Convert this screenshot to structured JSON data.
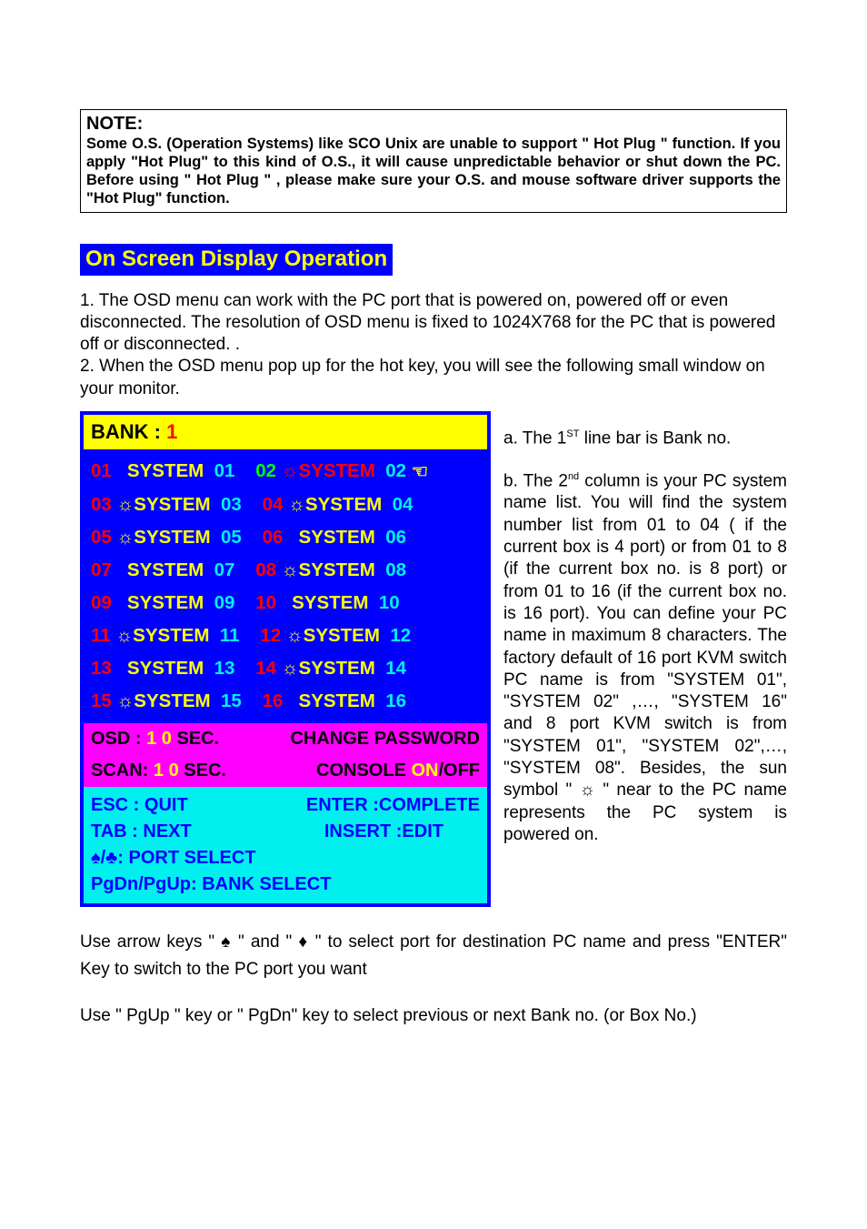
{
  "note": {
    "title_big": "N",
    "title_small": "OTE:",
    "body": "Some O.S. (Operation Systems) like SCO Unix are unable to support \" Hot Plug \" function. If you apply \"Hot Plug\" to this kind of O.S., it will cause unpredictable behavior or shut down the PC. Before using \" Hot Plug \" , please make sure your O.S. and mouse software driver supports the \"Hot Plug\" function."
  },
  "section_title": "On Screen Display Operation",
  "intro": "1. The OSD menu can work with the PC port that is powered on, powered off or even disconnected. The resolution of OSD menu is fixed to 1024X768 for the PC that is powered off or disconnected. .\n2. When the OSD menu pop up for the hot key, you will see the following small window on your monitor.",
  "osd": {
    "bank_label": "BANK :",
    "bank_no": "1",
    "rows": [
      {
        "l_idx": "01",
        "l_sun": false,
        "l_name": "SYSTEM",
        "l_style": "yel",
        "l_num": "01",
        "r_idx": "02",
        "r_sun": true,
        "r_name": "SYSTEM",
        "r_style": "red",
        "r_num": "02",
        "r_hand": true,
        "l_idx_style": "red",
        "r_idx_style": "green"
      },
      {
        "l_idx": "03",
        "l_sun": true,
        "l_name": "SYSTEM",
        "l_style": "yel",
        "l_num": "03",
        "r_idx": "04",
        "r_sun": true,
        "r_name": "SYSTEM",
        "r_style": "yel",
        "r_num": "04",
        "r_hand": false,
        "l_idx_style": "red",
        "r_idx_style": "red"
      },
      {
        "l_idx": "05",
        "l_sun": true,
        "l_name": "SYSTEM",
        "l_style": "yel",
        "l_num": "05",
        "r_idx": "06",
        "r_sun": false,
        "r_name": "SYSTEM",
        "r_style": "yel",
        "r_num": "06",
        "r_hand": false,
        "l_idx_style": "red",
        "r_idx_style": "red"
      },
      {
        "l_idx": "07",
        "l_sun": false,
        "l_name": "SYSTEM",
        "l_style": "yel",
        "l_num": "07",
        "r_idx": "08",
        "r_sun": true,
        "r_name": "SYSTEM",
        "r_style": "yel",
        "r_num": "08",
        "r_hand": false,
        "l_idx_style": "red",
        "r_idx_style": "red"
      },
      {
        "l_idx": "09",
        "l_sun": false,
        "l_name": "SYSTEM",
        "l_style": "yel",
        "l_num": "09",
        "r_idx": "10",
        "r_sun": false,
        "r_name": "SYSTEM",
        "r_style": "yel",
        "r_num": "10",
        "r_hand": false,
        "l_idx_style": "red",
        "r_idx_style": "red"
      },
      {
        "l_idx": "11",
        "l_sun": true,
        "l_name": "SYSTEM",
        "l_style": "yel",
        "l_num": "11",
        "r_idx": "12",
        "r_sun": true,
        "r_name": "SYSTEM",
        "r_style": "yel",
        "r_num": "12",
        "r_hand": false,
        "l_idx_style": "red",
        "r_idx_style": "red"
      },
      {
        "l_idx": "13",
        "l_sun": false,
        "l_name": "SYSTEM",
        "l_style": "yel",
        "l_num": "13",
        "r_idx": "14",
        "r_sun": true,
        "r_name": "SYSTEM",
        "r_style": "yel",
        "r_num": "14",
        "r_hand": false,
        "l_idx_style": "red",
        "r_idx_style": "red"
      },
      {
        "l_idx": "15",
        "l_sun": true,
        "l_name": "SYSTEM",
        "l_style": "yel",
        "l_num": "15",
        "r_idx": "16",
        "r_sun": false,
        "r_name": "SYSTEM",
        "r_style": "yel",
        "r_num": "16",
        "r_hand": false,
        "l_idx_style": "red",
        "r_idx_style": "red"
      }
    ],
    "pink1_left_pre": "OSD : ",
    "pink1_left_yel": "1 0",
    "pink1_left_post": " SEC.",
    "pink1_right": "CHANGE PASSWORD",
    "pink2_left_pre": "SCAN: ",
    "pink2_left_yel": "1 0",
    "pink2_left_post": " SEC.",
    "pink2_right_pre": "CONSOLE   ",
    "pink2_right_yel": "ON",
    "pink2_right_post": "/OFF",
    "cyan": {
      "r1l": "ESC : QUIT",
      "r1r": "ENTER :COMPLETE",
      "r2l": "TAB : NEXT",
      "r2r": "INSERT :EDIT",
      "r3": "♠/♣: PORT SELECT",
      "r4": "PgDn/PgUp: BANK   SELECT"
    }
  },
  "right": {
    "a": "a.  The 1ST line bar is Bank no.",
    "b": "b.  The 2nd column is your PC system name list. You will find the system number list from 01 to 04 ( if the current box is 4 port) or from 01 to 8 (if the current box no. is 8 port) or from 01 to 16 (if the current box no. is 16 port). You can define your PC name in maximum 8 characters. The factory default of 16 port KVM switch PC name is from \"SYSTEM 01\", \"SYSTEM 02\" ,…, \"SYSTEM 16\" and 8 port KVM switch is from \"SYSTEM 01\", \"SYSTEM 02\",…, \"SYSTEM 08\". Besides, the sun symbol \" ☼ \" near to the PC name represents the PC system is powered on."
  },
  "after1": "Use arrow keys \" ♠ \" and \" ♦ \" to select port for destination PC name and  press \"ENTER\" Key to switch to the PC port you want",
  "after2": "Use \" PgUp \" key or \" PgDn\" key to select previous or next Bank no. (or Box No.)"
}
